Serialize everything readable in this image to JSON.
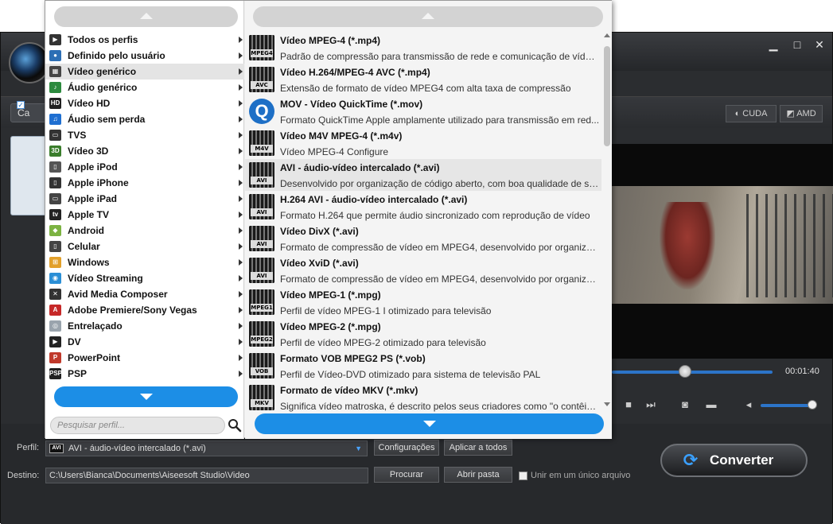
{
  "main": {
    "add_label": "Ca",
    "accel": [
      {
        "label": "CUDA"
      },
      {
        "label": "AMD"
      }
    ],
    "timecode": "00:01:40"
  },
  "bottom": {
    "profile_label": "Perfil:",
    "profile_value": "AVI - áudio-vídeo intercalado (*.avi)",
    "profile_icon_text": "AVI",
    "settings_button": "Configurações",
    "apply_all_button": "Aplicar a todos",
    "dest_label": "Destino:",
    "dest_value": "C:\\Users\\Bianca\\Documents\\Aiseesoft Studio\\Video",
    "browse_button": "Procurar",
    "open_folder_button": "Abrir pasta",
    "merge_label": "Unir em um único arquivo",
    "convert_button": "Converter"
  },
  "dropdown": {
    "search_placeholder": "Pesquisar perfil...",
    "categories": [
      {
        "label": "Todos os perfis",
        "icon": "play-icon",
        "color": "#333333",
        "glyph": "▶"
      },
      {
        "label": "Definido pelo usuário",
        "icon": "user-icon",
        "color": "#2d6fb5",
        "glyph": "●"
      },
      {
        "label": "Vídeo genérico",
        "icon": "film-icon",
        "color": "#444444",
        "glyph": "▦",
        "selected": true
      },
      {
        "label": "Áudio genérico",
        "icon": "audio-icon",
        "color": "#2c8a3e",
        "glyph": "♪"
      },
      {
        "label": "Vídeo HD",
        "icon": "hd-icon",
        "color": "#222222",
        "glyph": "HD"
      },
      {
        "label": "Áudio sem perda",
        "icon": "music-note-icon",
        "color": "#1f6fd1",
        "glyph": "♫"
      },
      {
        "label": "TVS",
        "icon": "tv-icon",
        "color": "#333333",
        "glyph": "▭"
      },
      {
        "label": "Vídeo 3D",
        "icon": "3d-icon",
        "color": "#3a7d2b",
        "glyph": "3D"
      },
      {
        "label": "Apple iPod",
        "icon": "ipod-icon",
        "color": "#555555",
        "glyph": "▯"
      },
      {
        "label": "Apple iPhone",
        "icon": "iphone-icon",
        "color": "#333333",
        "glyph": "▯"
      },
      {
        "label": "Apple iPad",
        "icon": "ipad-icon",
        "color": "#444444",
        "glyph": "▭"
      },
      {
        "label": "Apple TV",
        "icon": "apple-tv-icon",
        "color": "#222222",
        "glyph": "tv"
      },
      {
        "label": "Android",
        "icon": "android-icon",
        "color": "#7cb342",
        "glyph": "◆"
      },
      {
        "label": "Celular",
        "icon": "cellphone-icon",
        "color": "#444444",
        "glyph": "▯"
      },
      {
        "label": "Windows",
        "icon": "windows-icon",
        "color": "#e2a02a",
        "glyph": "⊞"
      },
      {
        "label": "Vídeo Streaming",
        "icon": "globe-icon",
        "color": "#2b8fd6",
        "glyph": "◉"
      },
      {
        "label": "Avid Media Composer",
        "icon": "avid-icon",
        "color": "#333333",
        "glyph": "✕"
      },
      {
        "label": "Adobe Premiere/Sony Vegas",
        "icon": "adobe-icon",
        "color": "#c62828",
        "glyph": "A"
      },
      {
        "label": "Entrelaçado",
        "icon": "disc-icon",
        "color": "#9aa4ad",
        "glyph": "◎"
      },
      {
        "label": "DV",
        "icon": "dv-icon",
        "color": "#222222",
        "glyph": "▶"
      },
      {
        "label": "PowerPoint",
        "icon": "powerpoint-icon",
        "color": "#c0392b",
        "glyph": "P"
      },
      {
        "label": "PSP",
        "icon": "psp-icon",
        "color": "#222222",
        "glyph": "PSP"
      }
    ],
    "formats": [
      {
        "name": "Vídeo MPEG-4 (*.mp4)",
        "desc": "Padrão de compressão para transmissão de rede e comunicação de vídeo ...",
        "badge": "MPEG4"
      },
      {
        "name": "Vídeo H.264/MPEG-4 AVC (*.mp4)",
        "desc": "Extensão de formato de vídeo MPEG4 com alta taxa de compressão",
        "badge": "AVC"
      },
      {
        "name": "MOV - Vídeo QuickTime (*.mov)",
        "desc": "Formato QuickTime Apple amplamente utilizado para transmissão em red...",
        "badge": "Q",
        "quicktime": true
      },
      {
        "name": "Vídeo M4V MPEG-4 (*.m4v)",
        "desc": "Vídeo MPEG-4 Configure",
        "badge": "M4V"
      },
      {
        "name": "AVI - áudio-vídeo intercalado (*.avi)",
        "desc": "Desenvolvido por organização de código aberto, com boa qualidade de so...",
        "badge": "AVI",
        "selected": true
      },
      {
        "name": "H.264 AVI - áudio-vídeo intercalado (*.avi)",
        "desc": "Formato H.264 que permite áudio sincronizado com reprodução de vídeo",
        "badge": "AVI"
      },
      {
        "name": "Vídeo DivX (*.avi)",
        "desc": "Formato de compressão de vídeo em MPEG4, desenvolvido por organizaç...",
        "badge": "AVI"
      },
      {
        "name": "Vídeo XviD (*.avi)",
        "desc": "Formato de compressão de vídeo em MPEG4, desenvolvido por organizaç...",
        "badge": "AVI"
      },
      {
        "name": "Vídeo MPEG-1 (*.mpg)",
        "desc": "Perfil de vídeo MPEG-1 I otimizado para televisão",
        "badge": "MPEG1"
      },
      {
        "name": "Vídeo MPEG-2 (*.mpg)",
        "desc": "Perfil de vídeo MPEG-2 otimizado para televisão",
        "badge": "MPEG2"
      },
      {
        "name": "Formato VOB MPEG2 PS (*.vob)",
        "desc": "Perfil de Vídeo-DVD otimizado para sistema de televisão PAL",
        "badge": "VOB"
      },
      {
        "name": "Formato de vídeo MKV (*.mkv)",
        "desc": "Significa vídeo matroska, é descrito pelos seus criadores como \"o contêine...",
        "badge": "MKV"
      }
    ]
  }
}
